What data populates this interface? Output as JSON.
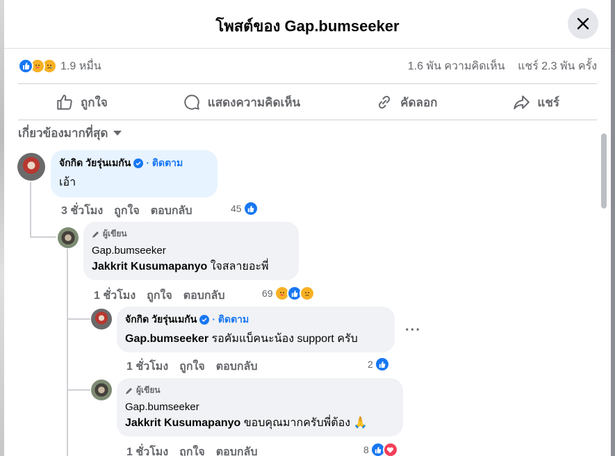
{
  "dialog": {
    "title": "โพสต์ของ Gap.bumseeker"
  },
  "stats": {
    "reaction_count": "1.9 หมื่น",
    "comments": "1.6 พัน ความคิดเห็น",
    "shares": "แชร์ 2.3 พัน ครั้ง"
  },
  "actions": {
    "like": "ถูกใจ",
    "comment": "แสดงความคิดเห็น",
    "copy": "คัดลอก",
    "share": "แชร์"
  },
  "sort": {
    "label": "เกี่ยวข้องมากที่สุด"
  },
  "comments": [
    {
      "name": "จักกิด วัยรุ่นเมกัน",
      "follow": "· ติดตาม",
      "text": "เอ้า",
      "time": "3 ชั่วโมง",
      "like": "ถูกใจ",
      "reply": "ตอบกลับ",
      "count": "45"
    },
    {
      "author_tag": "ผู้เขียน",
      "name": "Gap.bumseeker",
      "mention": "Jakkrit Kusumapanyo",
      "text": " ใจสลายอะพี่",
      "time": "1 ชั่วโมง",
      "like": "ถูกใจ",
      "reply": "ตอบกลับ",
      "count": "69"
    },
    {
      "name": "จักกิด วัยรุ่นเมกัน",
      "follow": "· ติดตาม",
      "mention": "Gap.bumseeker",
      "text": " รอคัมแบ็คนะน้อง support ครับ",
      "time": "1 ชั่วโมง",
      "like": "ถูกใจ",
      "reply": "ตอบกลับ",
      "count": "2",
      "more": "···"
    },
    {
      "author_tag": "ผู้เขียน",
      "name": "Gap.bumseeker",
      "mention": "Jakkrit Kusumapanyo",
      "text": " ขอบคุณมากครับพี่ต้อง",
      "emoji": "🙏",
      "time": "1 ชั่วโมง",
      "like": "ถูกใจ",
      "reply": "ตอบกลับ",
      "count": "8"
    }
  ],
  "colors": {
    "accent": "#1877f2",
    "like": "#1877f2",
    "love": "#f33e58",
    "care": "#f7b125"
  }
}
